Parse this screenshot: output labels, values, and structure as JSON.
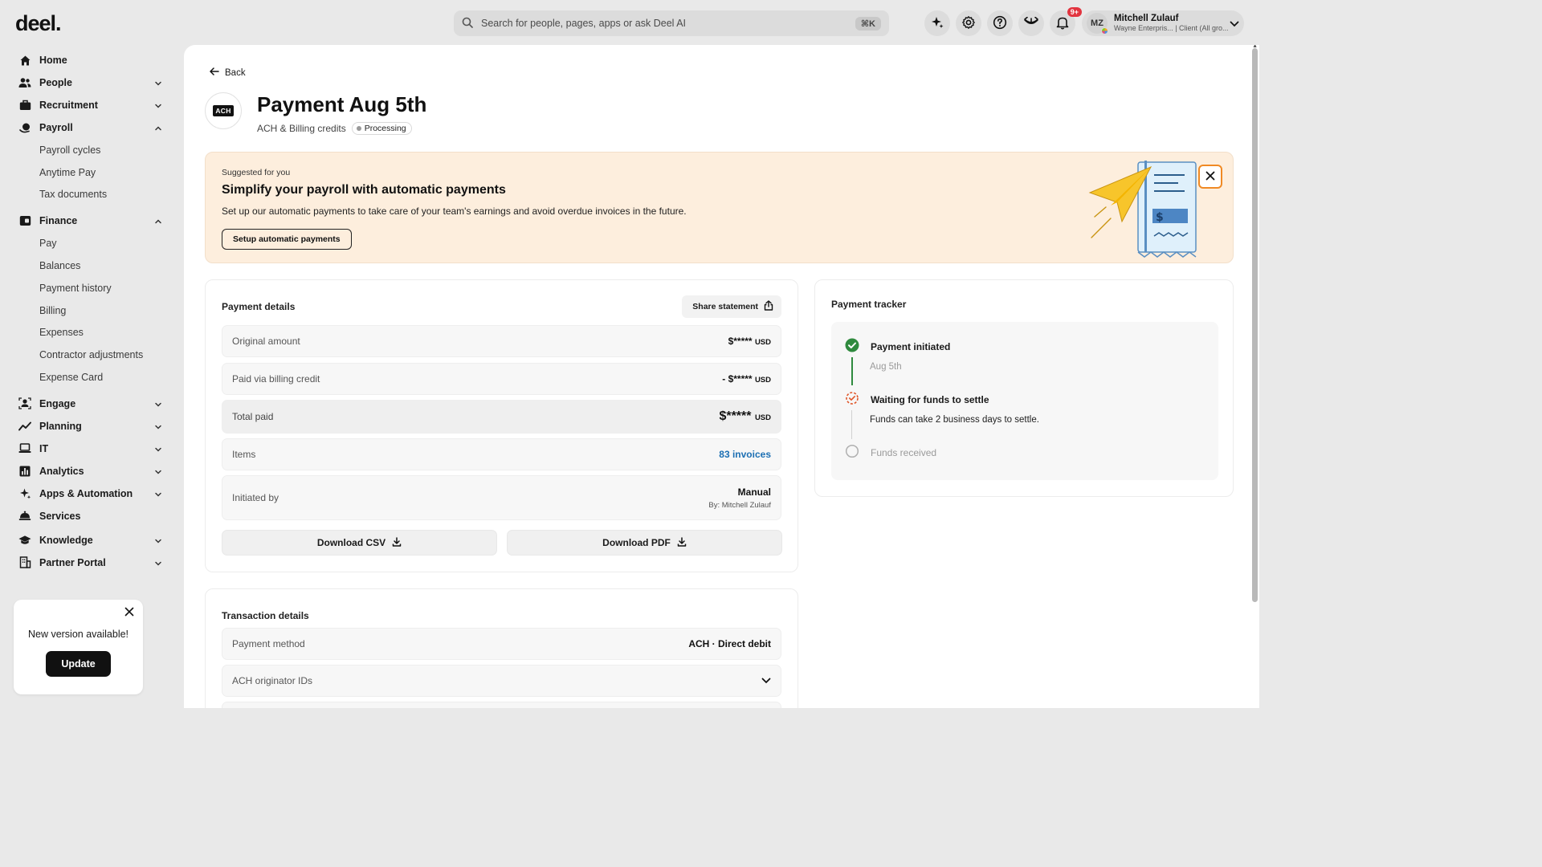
{
  "app": {
    "logo": "deel.",
    "search_placeholder": "Search for people, pages, apps or ask Deel AI",
    "search_shortcut": "⌘K",
    "notifications_badge": "9+",
    "user": {
      "initials": "MZ",
      "name": "Mitchell Zulauf",
      "subtitle": "Wayne Enterpris... | Client (All gro..."
    }
  },
  "sidebar": {
    "home": "Home",
    "people": "People",
    "recruitment": "Recruitment",
    "payroll": "Payroll",
    "payroll_sub": [
      "Payroll cycles",
      "Anytime Pay",
      "Tax documents"
    ],
    "finance": "Finance",
    "finance_sub": [
      "Pay",
      "Balances",
      "Payment history",
      "Billing",
      "Expenses",
      "Contractor adjustments",
      "Expense Card"
    ],
    "engage": "Engage",
    "planning": "Planning",
    "it": "IT",
    "analytics": "Analytics",
    "apps": "Apps & Automation",
    "services": "Services",
    "knowledge": "Knowledge",
    "partner": "Partner Portal"
  },
  "update_card": {
    "message": "New version available!",
    "button": "Update"
  },
  "page": {
    "back": "Back",
    "logo_text": "ACH",
    "title": "Payment Aug 5th",
    "subtitle": "ACH & Billing credits",
    "status": "Processing"
  },
  "promo": {
    "eyebrow": "Suggested for you",
    "headline": "Simplify your payroll with automatic payments",
    "description": "Set up our automatic payments to take care of your team's earnings and avoid overdue invoices in the future.",
    "cta": "Setup automatic payments"
  },
  "payment_details": {
    "title": "Payment details",
    "share": "Share statement",
    "original_label": "Original amount",
    "original_value": "$*****",
    "original_cur": "USD",
    "credit_label": "Paid via billing credit",
    "credit_value": "- $*****",
    "credit_cur": "USD",
    "total_label": "Total paid",
    "total_value": "$*****",
    "total_cur": "USD",
    "items_label": "Items",
    "items_value": "83 invoices",
    "initiated_label": "Initiated by",
    "initiated_value": "Manual",
    "initiated_by": "By: Mitchell Zulauf",
    "download_csv": "Download CSV",
    "download_pdf": "Download PDF"
  },
  "transaction_details": {
    "title": "Transaction details",
    "method_label": "Payment method",
    "method_value": "ACH · Direct debit",
    "originator_label": "ACH originator IDs"
  },
  "tracker": {
    "title": "Payment tracker",
    "step1": "Payment initiated",
    "step1_date": "Aug 5th",
    "step2": "Waiting for funds to settle",
    "step2_note": "Funds can take 2 business days to settle.",
    "step3": "Funds received"
  }
}
